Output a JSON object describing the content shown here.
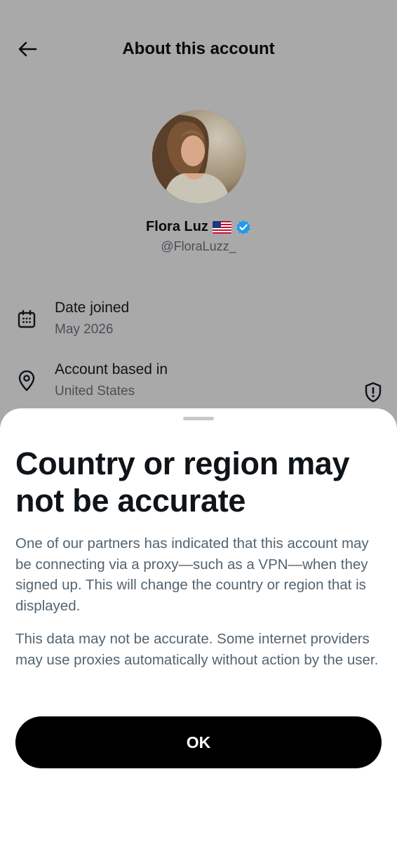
{
  "header": {
    "title": "About this account"
  },
  "profile": {
    "name": "Flora Luz",
    "flag": "🇺🇸",
    "handle": "@FloraLuzz_"
  },
  "info": [
    {
      "label": "Date joined",
      "value": "May 2026",
      "icon": "calendar-icon"
    },
    {
      "label": "Account based in",
      "value": "United States",
      "icon": "location-pin-icon"
    }
  ],
  "sheet": {
    "title": "Country or region may not be accurate",
    "paragraph1": "One of our partners has indicated that this account may be connecting via a proxy—such as a VPN—when they signed up. This will change the country or region that is displayed.",
    "paragraph2": "This data may not be accurate. Some internet providers may use proxies automatically without action by the user.",
    "ok_label": "OK"
  },
  "colors": {
    "dim_background": "#a9a9a9",
    "verified_blue": "#1d9bf0",
    "secondary_text": "#536471",
    "button_black": "#000000"
  }
}
